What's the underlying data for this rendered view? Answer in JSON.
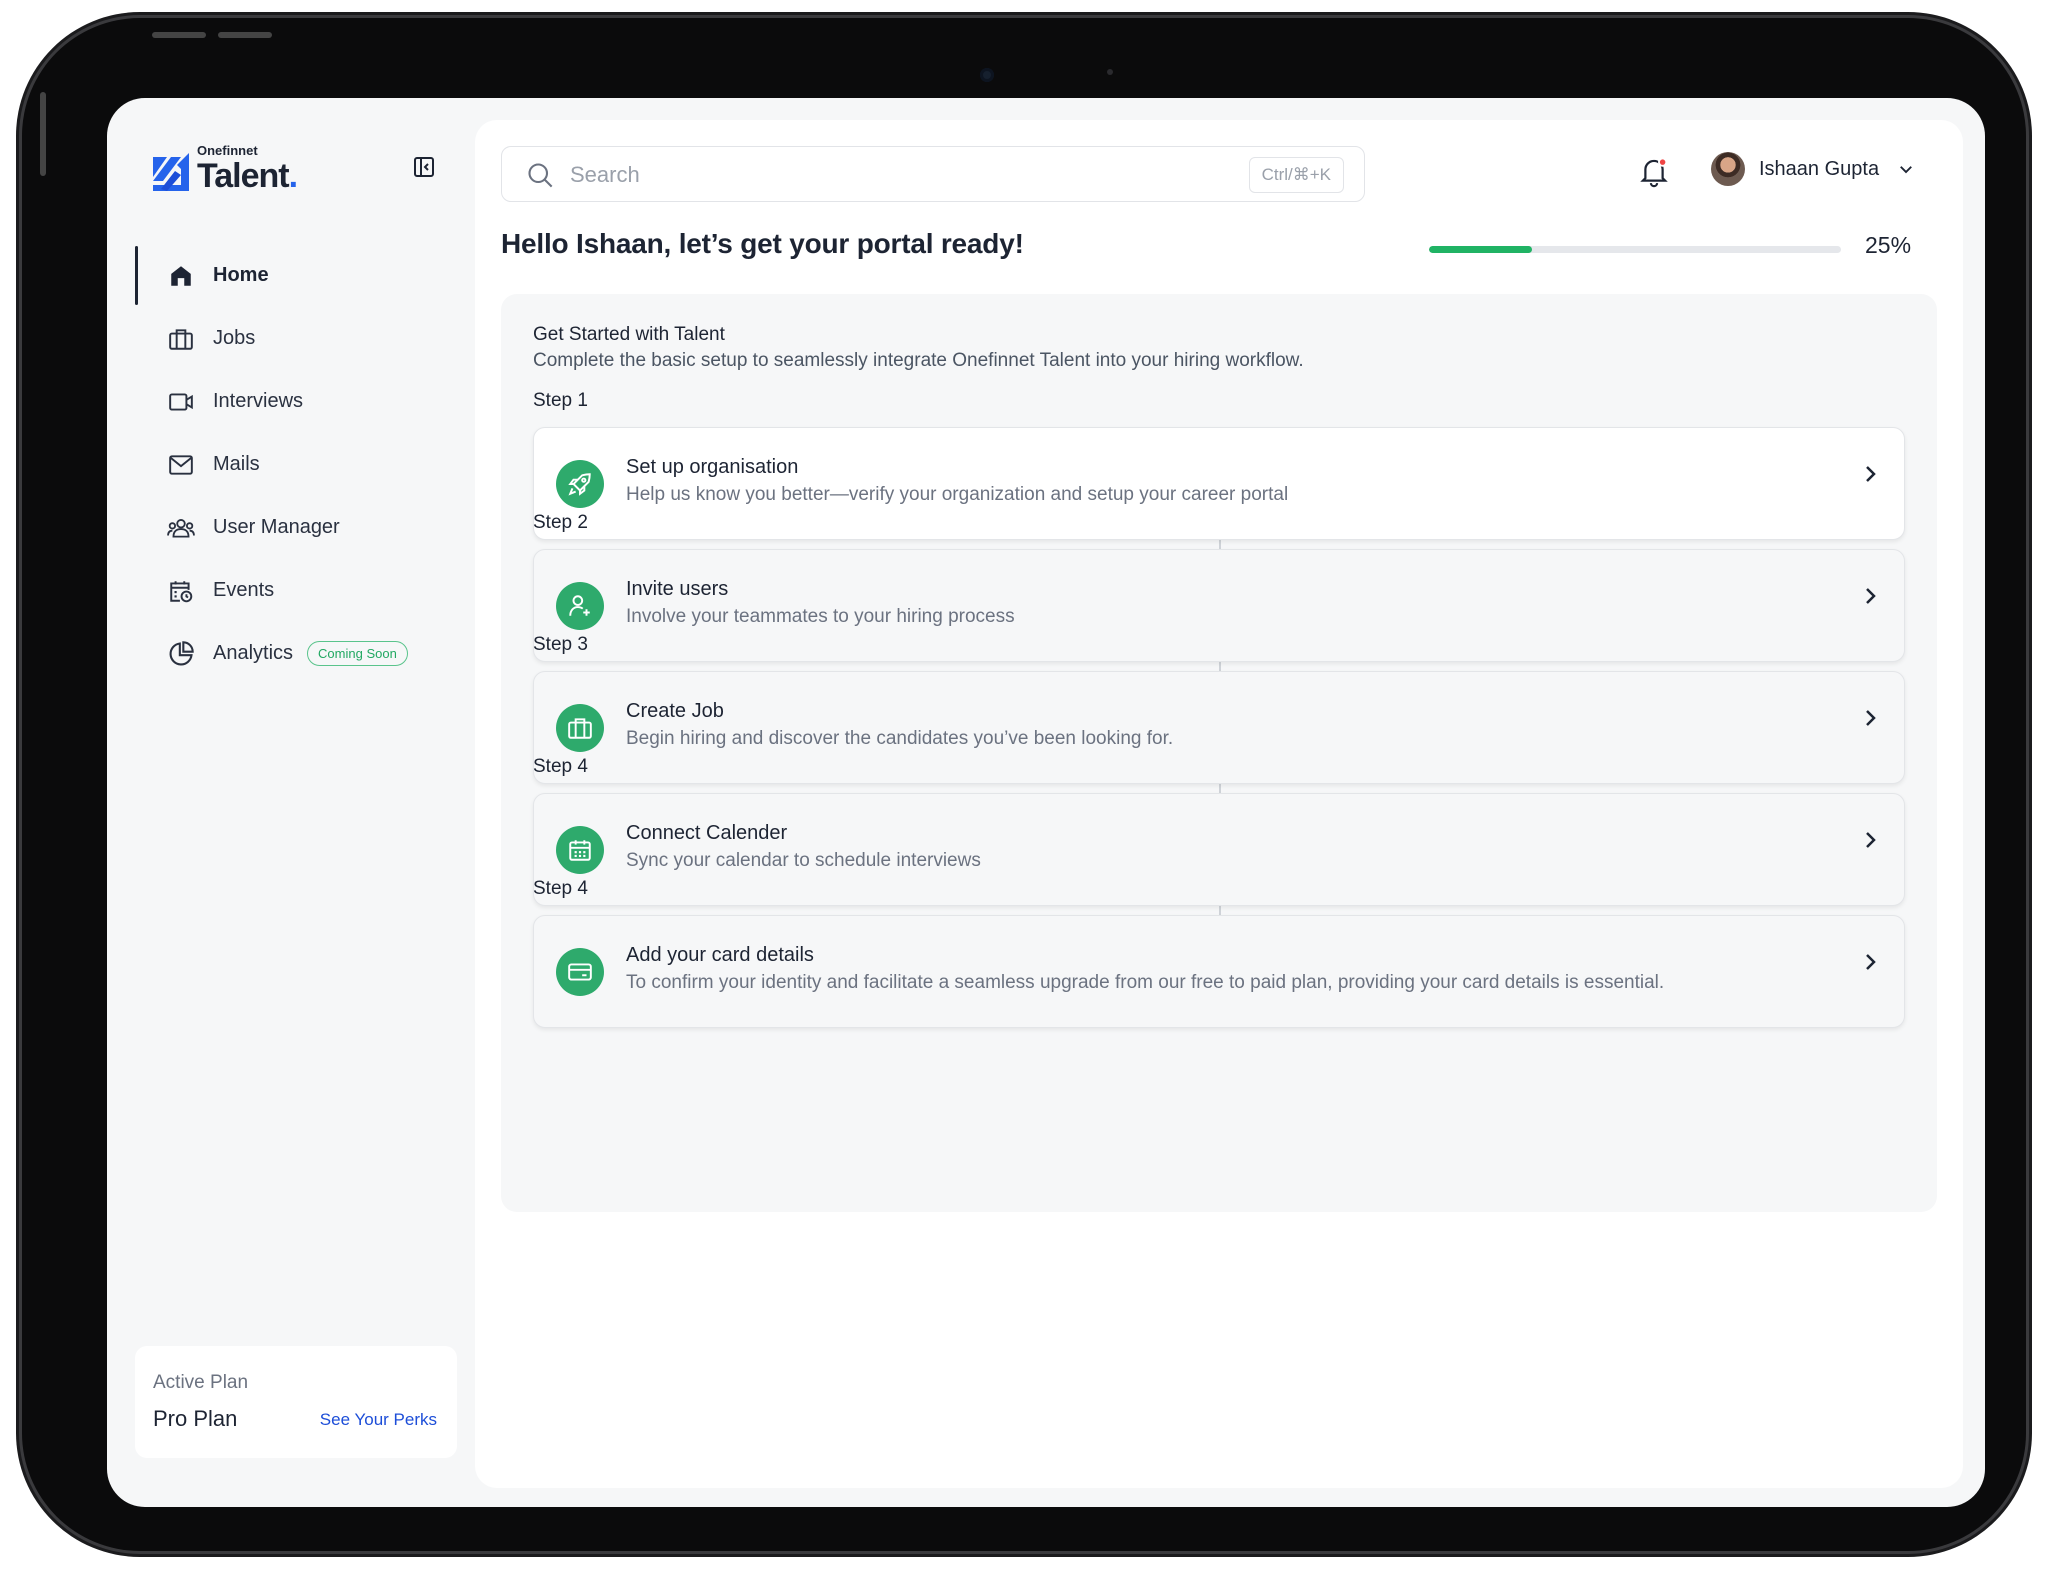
{
  "brand": {
    "company": "Onefinnet",
    "product": "Talent",
    "accent_color": "#2563eb",
    "success_color": "#20b364"
  },
  "sidebar": {
    "items": [
      {
        "label": "Home",
        "icon": "home-icon",
        "active": true
      },
      {
        "label": "Jobs",
        "icon": "briefcase-icon"
      },
      {
        "label": "Interviews",
        "icon": "video-icon"
      },
      {
        "label": "Mails",
        "icon": "mail-icon"
      },
      {
        "label": "User Manager",
        "icon": "users-icon"
      },
      {
        "label": "Events",
        "icon": "calendar-clock-icon"
      },
      {
        "label": "Analytics",
        "icon": "pie-chart-icon",
        "badge": "Coming Soon"
      }
    ],
    "plan": {
      "label": "Active Plan",
      "name": "Pro Plan",
      "link": "See Your Perks"
    }
  },
  "header": {
    "search_placeholder": "Search",
    "search_shortcut": "Ctrl/⌘+K",
    "user_name": "Ishaan Gupta"
  },
  "main": {
    "greeting": "Hello Ishaan, let’s get your portal ready!",
    "progress_percent": 25,
    "progress_label": "25%",
    "panel_title": "Get Started with Talent",
    "panel_subtitle": "Complete the basic setup to seamlessly integrate Onefinnet Talent into your hiring workflow.",
    "steps": [
      {
        "step": "Step 1",
        "title": "Set up organisation",
        "desc": "Help us know you better—verify your organization and setup your career portal",
        "icon": "rocket-icon"
      },
      {
        "step": "Step 2",
        "title": "Invite users",
        "desc": "Involve your teammates to your hiring process",
        "icon": "user-plus-icon"
      },
      {
        "step": "Step 3",
        "title": "Create Job",
        "desc": "Begin hiring and discover the candidates you’ve been looking for.",
        "icon": "briefcase-icon"
      },
      {
        "step": "Step 4",
        "title": "Connect Calender",
        "desc": "Sync your calendar to schedule interviews",
        "icon": "calendar-icon"
      },
      {
        "step": "Step 4",
        "title": "Add your card details",
        "desc": "To confirm your identity and facilitate a seamless upgrade from our free to paid plan, providing your card details is essential.",
        "icon": "credit-card-icon"
      }
    ]
  }
}
